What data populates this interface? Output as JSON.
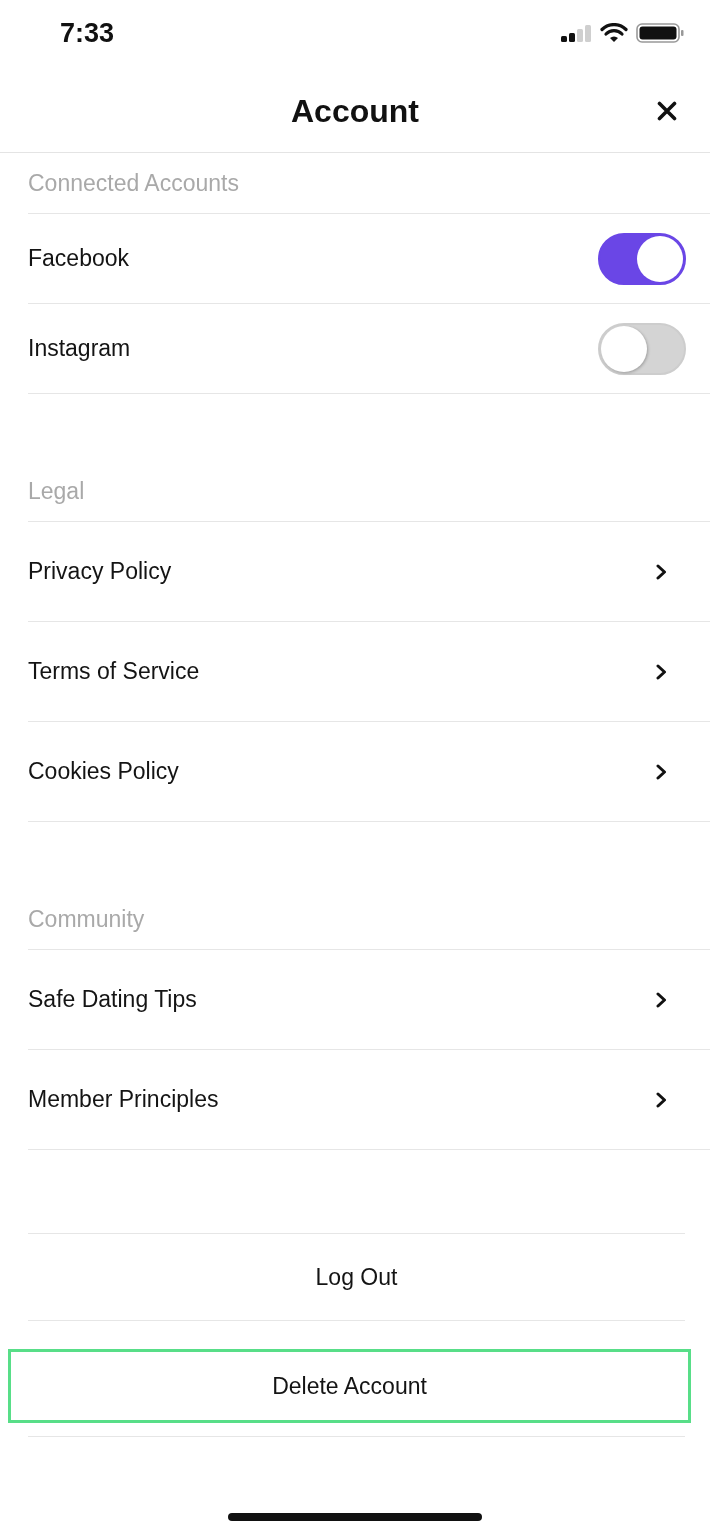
{
  "status_bar": {
    "time": "7:33"
  },
  "header": {
    "title": "Account"
  },
  "sections": [
    {
      "title": "Connected Accounts",
      "items": [
        {
          "kind": "toggle",
          "label": "Facebook",
          "on": true
        },
        {
          "kind": "toggle",
          "label": "Instagram",
          "on": false
        }
      ]
    },
    {
      "title": "Legal",
      "items": [
        {
          "kind": "link",
          "label": "Privacy Policy"
        },
        {
          "kind": "link",
          "label": "Terms of Service"
        },
        {
          "kind": "link",
          "label": "Cookies Policy"
        }
      ]
    },
    {
      "title": "Community",
      "items": [
        {
          "kind": "link",
          "label": "Safe Dating Tips"
        },
        {
          "kind": "link",
          "label": "Member Principles"
        }
      ]
    }
  ],
  "actions": [
    {
      "label": "Log Out",
      "highlighted": false
    },
    {
      "label": "Delete Account",
      "highlighted": true
    }
  ]
}
